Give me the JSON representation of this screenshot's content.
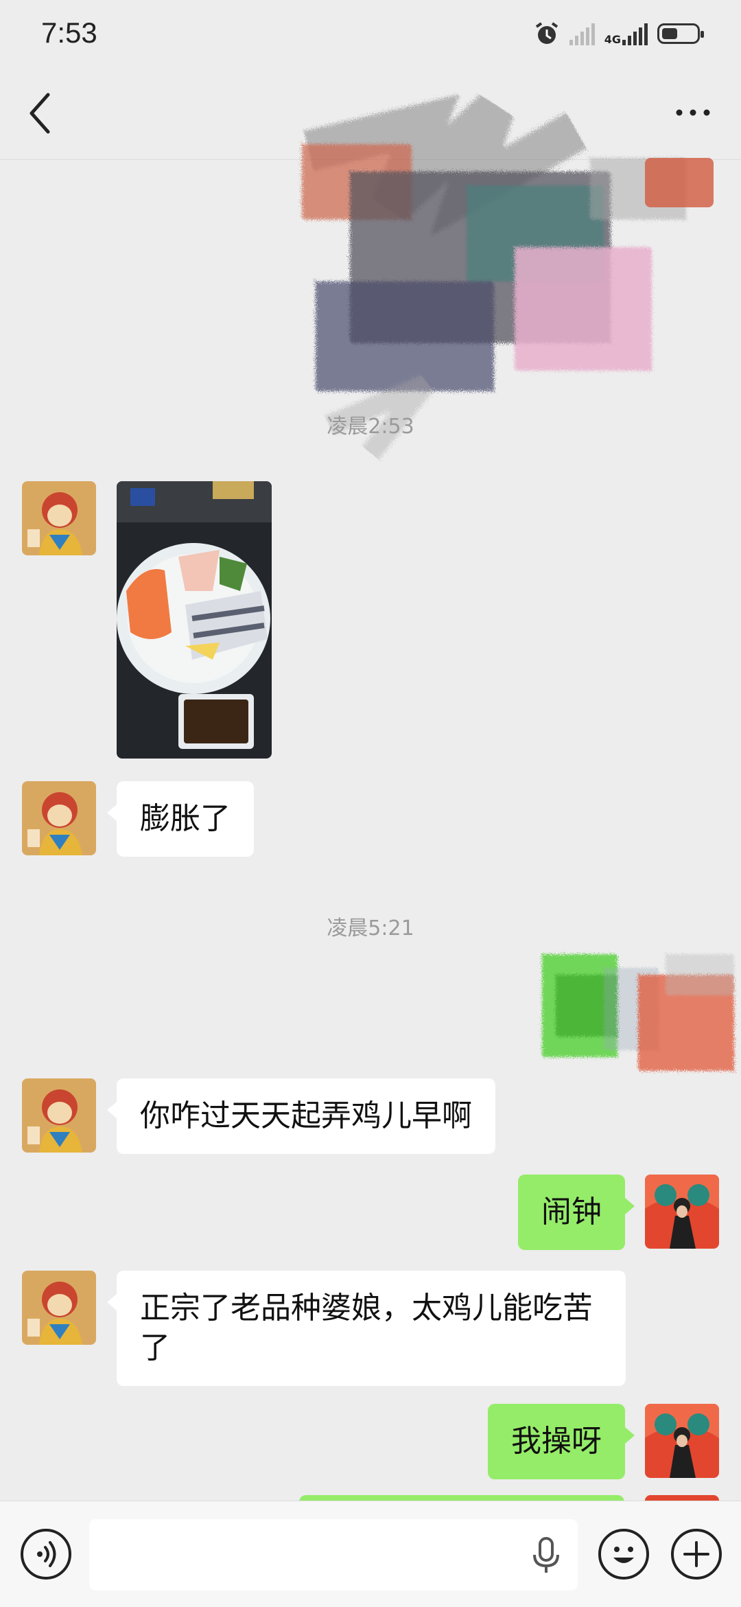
{
  "status_bar": {
    "time": "7:53",
    "network": "4G",
    "icons": [
      "alarm-icon",
      "signal-off-icon",
      "signal-icon",
      "battery-icon"
    ]
  },
  "nav": {
    "back_icon": "chevron-left-icon",
    "more_icon": "more-dots-icon"
  },
  "messages": {
    "time_1": "凌晨2:53",
    "time_2": "凌晨5:21",
    "msg_1": "膨胀了",
    "msg_2": "你咋过天天起弄鸡儿早啊",
    "msg_3": "闹钟",
    "msg_4": "正宗了老品种婆娘，太鸡儿能吃苦了",
    "msg_5": "我操呀"
  },
  "bottom_bar": {
    "voice_icon": "voice-icon",
    "mic_icon": "microphone-icon",
    "emoji_icon": "emoji-icon",
    "add_icon": "plus-icon",
    "input_value": ""
  },
  "colors": {
    "background": "#ededed",
    "outgoing_bubble": "#95ec69",
    "incoming_bubble": "#ffffff"
  }
}
